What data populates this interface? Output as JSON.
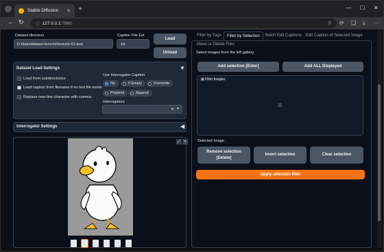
{
  "browser": {
    "tab_title": "Stable Diffusion",
    "url_host": "127.0.0.1",
    "url_port": ":7860"
  },
  "left": {
    "dataset_dir_label": "Dataset directory",
    "dataset_dir_value": "D:\\data\\dataset-toricchi\\toricchi-01-test",
    "caption_ext_label": "Caption File Ext",
    "caption_ext_value": ".txt",
    "load_label": "Load",
    "unload_label": "Unload",
    "load_settings_title": "Dataset Load Settings",
    "opt_subdirs": "Load from subdirectories",
    "opt_caption_from_filename": "Load caption from filename if no text file exists",
    "opt_replace_newline": "Replace new-line character with comma",
    "use_interrogator_label": "Use Interrogator Caption",
    "radio_no": "No",
    "radio_if_empty": "If Empty",
    "radio_overwrite": "Overwrite",
    "radio_prepend": "Prepend",
    "radio_append": "Append",
    "interrogators_label": "Interrogators",
    "interrogator_settings_title": "Interrogator Settings"
  },
  "right": {
    "tabs": [
      "Filter by Tags",
      "Filter by Selection",
      "Batch Edit Captions",
      "Edit Caption of Selected Image",
      "Move or Delete Files"
    ],
    "instruction": "Select images from the left gallery.",
    "add_selection": "Add selection [Enter]",
    "add_all": "Add ALL Displayed",
    "filter_images_label": "Filter Images",
    "selected_image_label": "Selected Image :",
    "remove_selection_line1": "Remove selection",
    "remove_selection_line2": "[Delete]",
    "invert_selection": "Invert selection",
    "clear_selection": "Clear selection",
    "apply_filter": "Apply selection filter"
  },
  "colors": {
    "accent": "#f97316",
    "page_bg": "#0b0f19",
    "button": "#4b5563"
  }
}
